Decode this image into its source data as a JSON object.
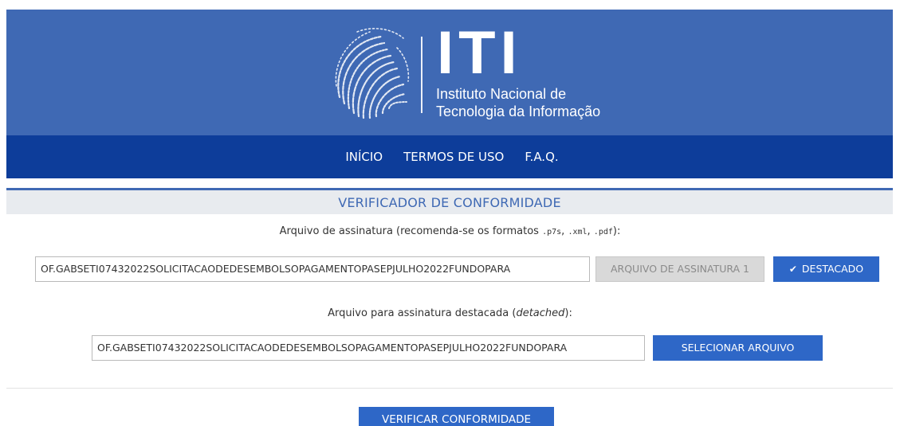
{
  "header": {
    "logo_abbr": "ITI",
    "logo_line1": "Instituto Nacional de",
    "logo_line2": "Tecnologia da Informação",
    "bg_color": "#3f69b4"
  },
  "nav": {
    "items": [
      {
        "label": "INÍCIO"
      },
      {
        "label": "TERMOS DE USO"
      },
      {
        "label": "F.A.Q."
      }
    ],
    "bg_color": "#0d3d9a"
  },
  "section_title": "VERIFICADOR DE CONFORMIDADE",
  "signature": {
    "label_before": "Arquivo de assinatura (recomenda-se os formatos ",
    "formats": [
      ".p7s",
      ".xml",
      ".pdf"
    ],
    "label_after": "):",
    "file_value": "OF.GABSETI07432022SOLICITACAODEDESEMBOLSOPAGAMENTOPASEPJULHO2022FUNDOPARA",
    "select_button": "ARQUIVO DE ASSINATURA 1",
    "detached_toggle": "DESTACADO",
    "detached_checked": true
  },
  "detached_file": {
    "label_before": "Arquivo para assinatura destacada (",
    "label_em": "detached",
    "label_after": "):",
    "file_value": "OF.GABSETI07432022SOLICITACAODEDESEMBOLSOPAGAMENTOPASEPJULHO2022FUNDOPARA",
    "select_button": "SELECIONAR ARQUIVO"
  },
  "verify_button": "VERIFICAR CONFORMIDADE",
  "colors": {
    "accent": "#2e67c7",
    "title_text": "#3f69b4"
  }
}
